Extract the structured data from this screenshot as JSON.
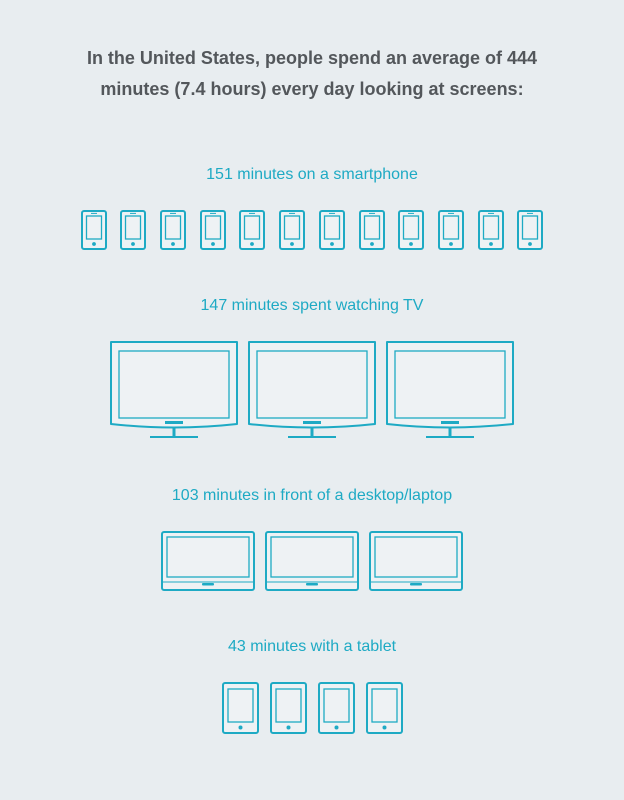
{
  "headline": {
    "line1": "In the United States, people spend an average of 444",
    "line2": "minutes (7.4 hours) every day looking at screens:"
  },
  "icon_color": "#1eaac4",
  "chart_data": {
    "type": "pictogram",
    "title": "In the United States, people spend an average of 444 minutes (7.4 hours) every day looking at screens:",
    "total_minutes": 444,
    "total_hours": 7.4,
    "categories": [
      "smartphone",
      "TV",
      "desktop/laptop",
      "tablet"
    ],
    "values": [
      151,
      147,
      103,
      43
    ],
    "icon_counts": [
      12,
      3,
      3,
      4
    ],
    "labels": [
      "151 minutes on a smartphone",
      "147 minutes spent watching TV",
      "103 minutes in front of a desktop/laptop",
      "43 minutes with a tablet"
    ],
    "icons": [
      "smartphone-icon",
      "tv-icon",
      "laptop-icon",
      "tablet-icon"
    ]
  }
}
